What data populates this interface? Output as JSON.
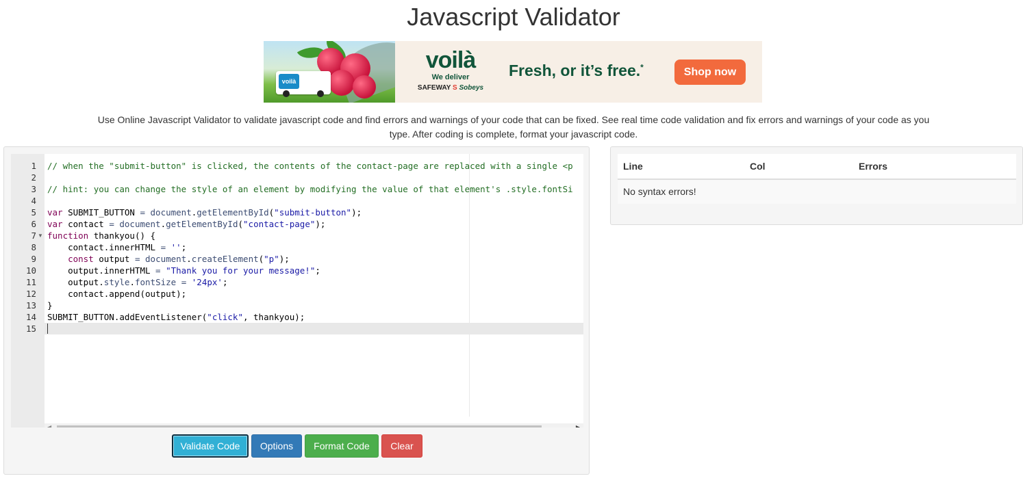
{
  "page": {
    "title": "Javascript Validator",
    "intro": "Use Online Javascript Validator to validate javascript code and find errors and warnings of your code that can be fixed. See real time code validation and fix errors and warnings of your code as you type. After coding is complete, format your javascript code."
  },
  "ad": {
    "brand": "voilà",
    "truck_logo": "voilà",
    "deliver": "We deliver",
    "store1": "SAFEWAY",
    "store2": "Sobeys",
    "tagline": "Fresh, or it’s free.",
    "tagline_mark": "*",
    "cta": "Shop now"
  },
  "editor": {
    "line_numbers": [
      "1",
      "2",
      "3",
      "4",
      "5",
      "6",
      "7",
      "8",
      "9",
      "10",
      "11",
      "12",
      "13",
      "14",
      "15"
    ],
    "lines": [
      "// when the \"submit-button\" is clicked, the contents of the contact-page are replaced with a single <p",
      "",
      "// hint: you can change the style of an element by modifying the value of that element's .style.fontSi",
      "",
      "var SUBMIT_BUTTON = document.getElementById(\"submit-button\");",
      "var contact = document.getElementById(\"contact-page\");",
      "function thankyou() {",
      "    contact.innerHTML = '';",
      "    const output = document.createElement(\"p\");",
      "    output.innerHTML = \"Thank you for your message!\";",
      "    output.style.fontSize = '24px';",
      "    contact.append(output);",
      "}",
      "SUBMIT_BUTTON.addEventListener(\"click\", thankyou);",
      ""
    ]
  },
  "buttons": {
    "validate": "Validate Code",
    "options": "Options",
    "format": "Format Code",
    "clear": "Clear"
  },
  "errors": {
    "headers": {
      "line": "Line",
      "col": "Col",
      "errors": "Errors"
    },
    "message": "No syntax errors!"
  },
  "colors": {
    "validate": "#31b0d5",
    "options": "#337ab7",
    "format": "#4cae4c",
    "clear": "#d9534f",
    "ad_green": "#11553a",
    "ad_cta": "#f26a3d"
  }
}
